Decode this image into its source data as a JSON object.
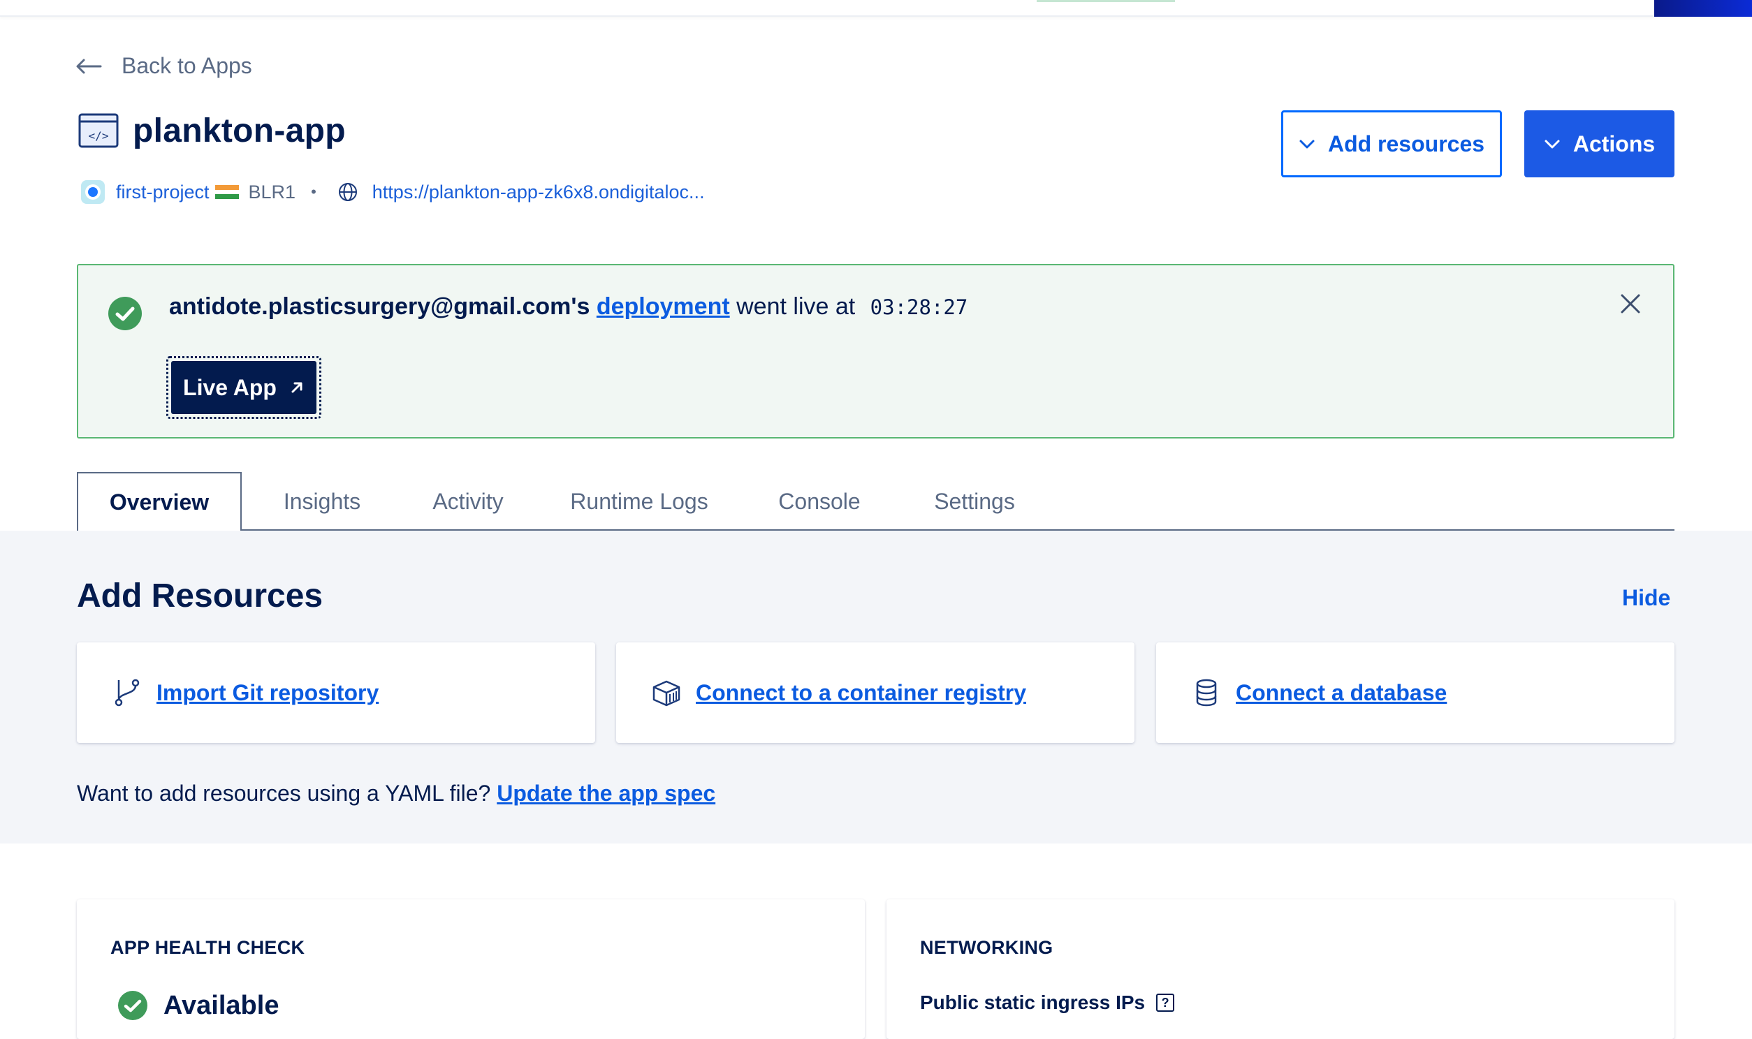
{
  "back": {
    "label": "Back to Apps"
  },
  "app": {
    "name": "plankton-app",
    "project": "first-project",
    "region": "BLR1",
    "separator": "•",
    "url": "https://plankton-app-zk6x8.ondigitaloc..."
  },
  "buttons": {
    "add_resources": "Add resources",
    "actions": "Actions"
  },
  "banner": {
    "email": "antidote.plasticsurgery@gmail.com's",
    "link": "deployment",
    "text": "went live at",
    "time": "03:28:27",
    "live_app": "Live App"
  },
  "tabs": [
    "Overview",
    "Insights",
    "Activity",
    "Runtime Logs",
    "Console",
    "Settings"
  ],
  "add_resources": {
    "title": "Add Resources",
    "hide": "Hide",
    "cards": [
      {
        "label": "Import Git repository",
        "icon": "git-branch-icon"
      },
      {
        "label": "Connect to a container registry",
        "icon": "container-icon"
      },
      {
        "label": "Connect a database",
        "icon": "database-icon"
      }
    ],
    "yaml_prompt": "Want to add resources using a YAML file?",
    "yaml_link": "Update the app spec"
  },
  "health": {
    "caption": "APP HEALTH CHECK",
    "status": "Available"
  },
  "networking": {
    "caption": "NETWORKING",
    "ingress_label": "Public static ingress IPs",
    "help": "?"
  },
  "colors": {
    "accent": "#0069ff",
    "primary_text": "#031b4e",
    "success": "#5ab773",
    "link": "#0b5be0"
  }
}
